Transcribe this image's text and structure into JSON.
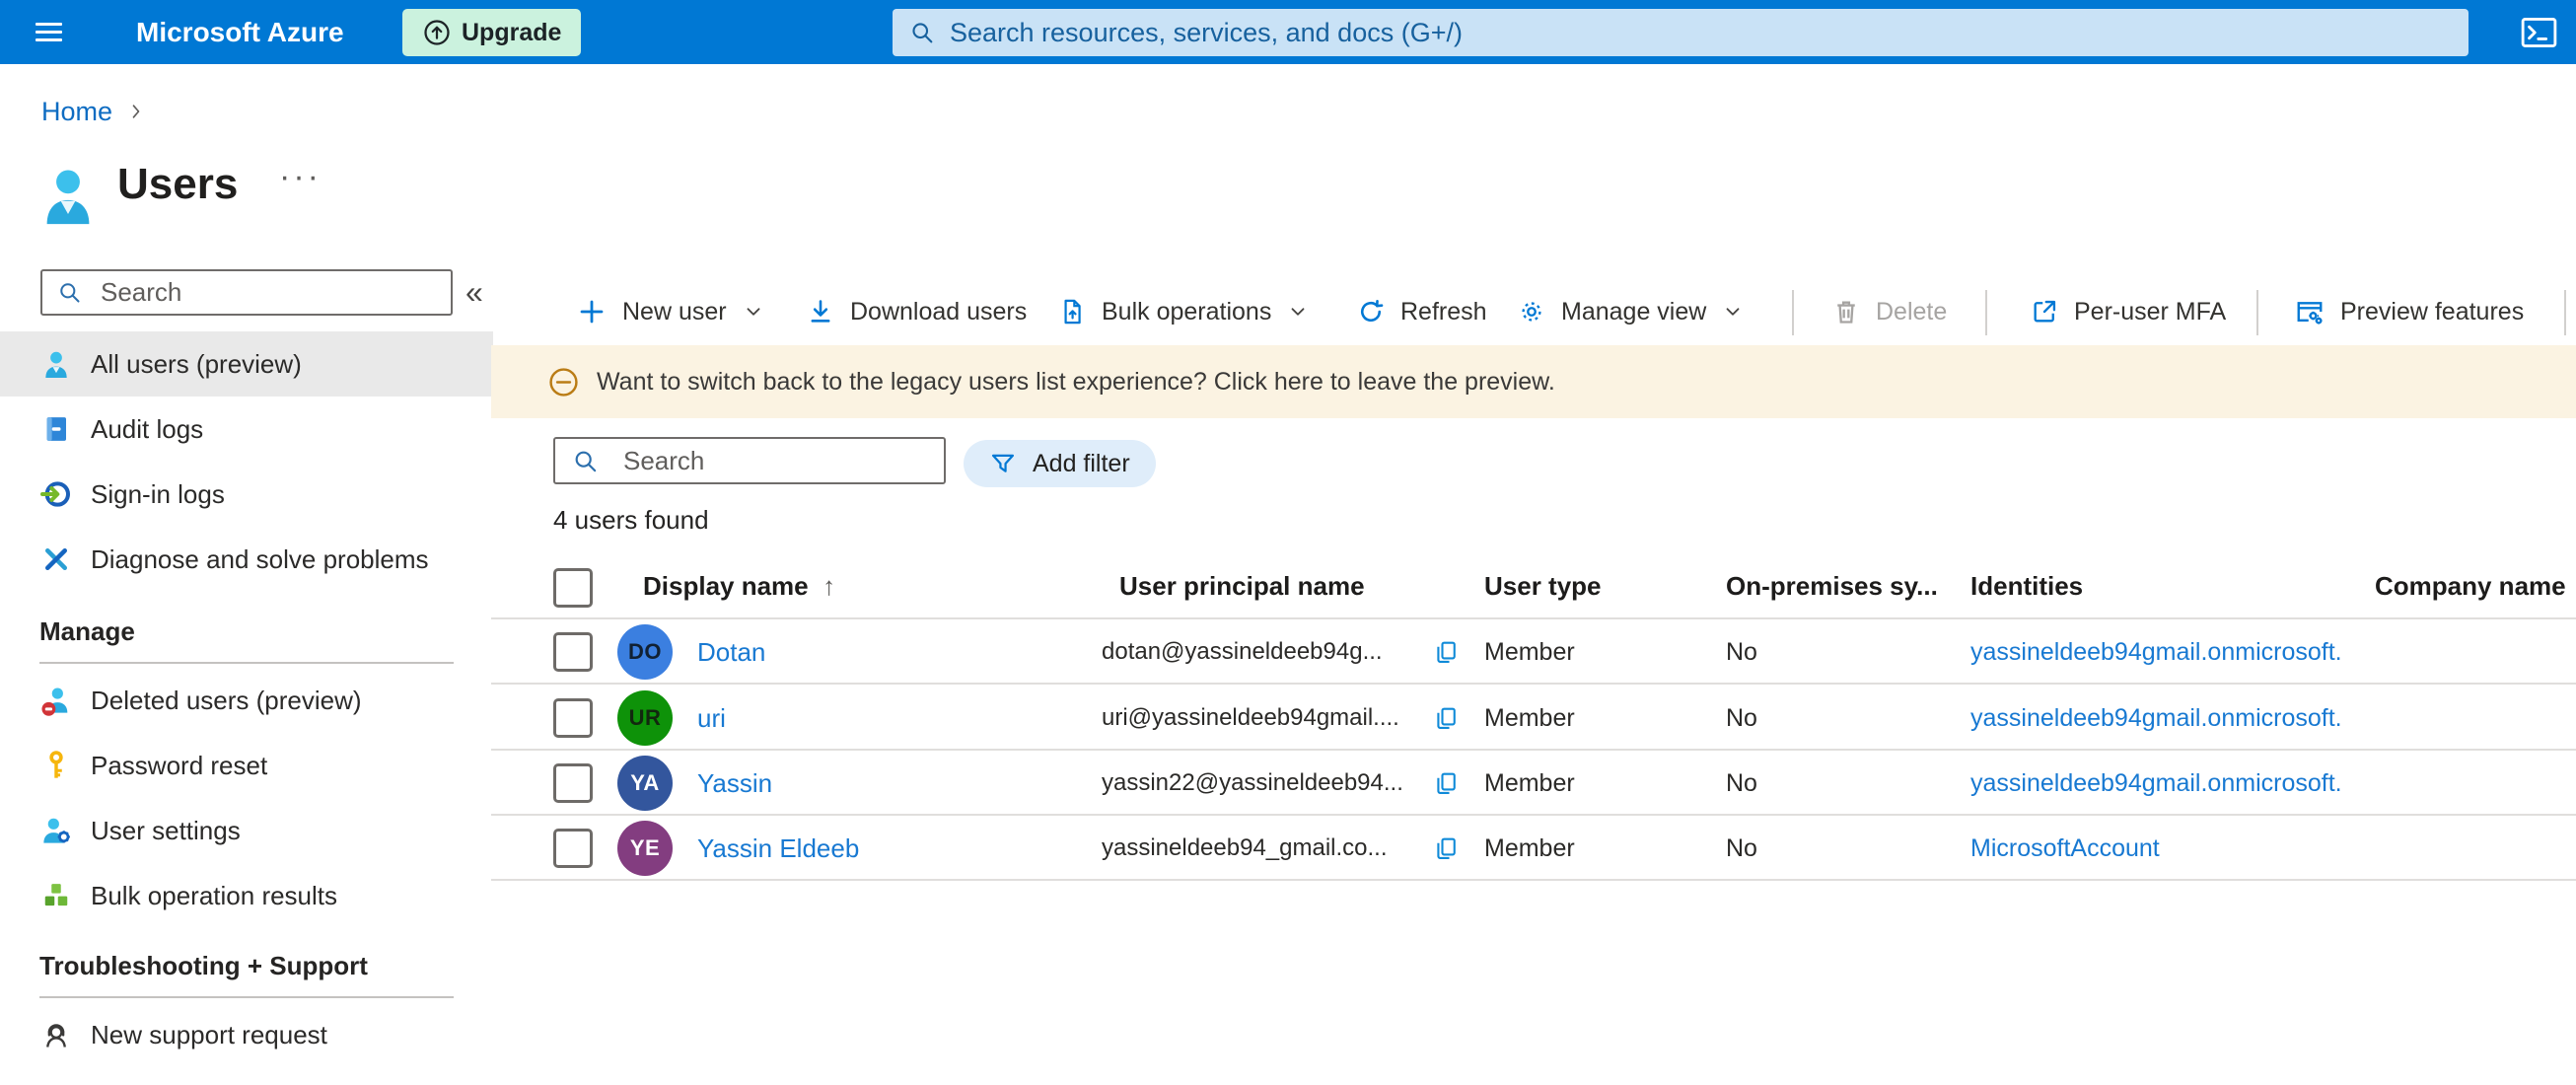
{
  "colors": {
    "topbar_bg": "#0078d4",
    "topbar_search_bg": "#c9e2f6",
    "topbar_search_fg": "#17619e",
    "upgrade_bg": "#cbf2de",
    "accent": "#0078d4",
    "link": "#1879d2",
    "link_dark": "#0e6cc2",
    "banner_bg": "#fbf3e2",
    "banner_icon": "#ba7c15",
    "selected_bg": "#e9e9e9",
    "pill_bg": "#dfedfa",
    "divider": "#c4c2c0",
    "row_line": "#e0dedc",
    "disabled": "#a6a4a2"
  },
  "topbar": {
    "brand": "Microsoft Azure",
    "upgrade_label": "Upgrade",
    "search_placeholder": "Search resources, services, and docs (G+/)"
  },
  "breadcrumb": {
    "home": "Home"
  },
  "page": {
    "title": "Users",
    "more_glyph": "···"
  },
  "sidebar": {
    "search_placeholder": "Search",
    "collapse_glyph": "«",
    "sections": [
      {
        "items": [
          {
            "label": "All users (preview)",
            "selected": true
          },
          {
            "label": "Audit logs"
          },
          {
            "label": "Sign-in logs"
          },
          {
            "label": "Diagnose and solve problems"
          }
        ]
      },
      {
        "header": "Manage",
        "items": [
          {
            "label": "Deleted users (preview)"
          },
          {
            "label": "Password reset"
          },
          {
            "label": "User settings"
          },
          {
            "label": "Bulk operation results"
          }
        ]
      },
      {
        "header": "Troubleshooting + Support",
        "items": [
          {
            "label": "New support request"
          }
        ]
      }
    ]
  },
  "toolbar": {
    "items": [
      {
        "label": "New user",
        "has_chevron": true
      },
      {
        "label": "Download users"
      },
      {
        "label": "Bulk operations",
        "has_chevron": true
      },
      {
        "label": "Refresh"
      },
      {
        "label": "Manage view",
        "has_chevron": true
      },
      {
        "label": "Delete",
        "disabled": true
      },
      {
        "label": "Per-user MFA"
      },
      {
        "label": "Preview features"
      }
    ]
  },
  "banner": {
    "text": "Want to switch back to the legacy users list experience? Click here to leave the preview."
  },
  "filters": {
    "search_placeholder": "Search",
    "add_filter_label": "Add filter"
  },
  "results": {
    "count_text": "4 users found"
  },
  "table": {
    "columns": [
      "Display name",
      "User principal name",
      "User type",
      "On-premises sy...",
      "Identities",
      "Company name"
    ],
    "sort_arrow": "↑",
    "rows": [
      {
        "initials": "DO",
        "avatar_bg": "#3b7fe0",
        "avatar_fg": "#112133",
        "display_name": "Dotan",
        "upn": "dotan@yassineldeeb94g...",
        "user_type": "Member",
        "on_premises": "No",
        "identities": "yassineldeeb94gmail.onmicrosoft."
      },
      {
        "initials": "UR",
        "avatar_bg": "#0e9209",
        "avatar_fg": "#12280f",
        "display_name": "uri",
        "upn": "uri@yassineldeeb94gmail....",
        "user_type": "Member",
        "on_premises": "No",
        "identities": "yassineldeeb94gmail.onmicrosoft."
      },
      {
        "initials": "YA",
        "avatar_bg": "#33569d",
        "avatar_fg": "#ffffff",
        "display_name": "Yassin",
        "upn": "yassin22@yassineldeeb94...",
        "user_type": "Member",
        "on_premises": "No",
        "identities": "yassineldeeb94gmail.onmicrosoft."
      },
      {
        "initials": "YE",
        "avatar_bg": "#833d80",
        "avatar_fg": "#ffffff",
        "display_name": "Yassin Eldeeb",
        "upn": "yassineldeeb94_gmail.co...",
        "user_type": "Member",
        "on_premises": "No",
        "identities": "MicrosoftAccount"
      }
    ]
  }
}
